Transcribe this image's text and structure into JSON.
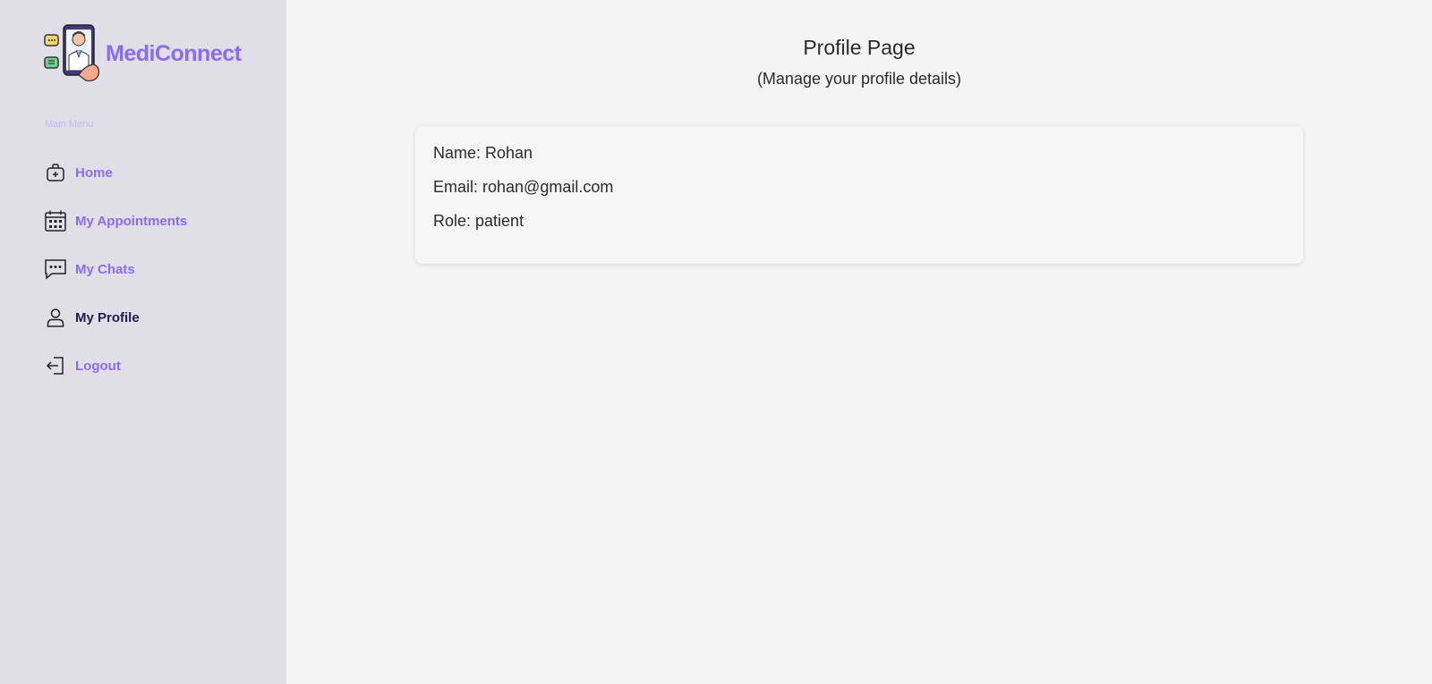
{
  "sidebar": {
    "brand": "MediConnect",
    "menu_heading": "Main Menu",
    "items": [
      {
        "label": "Home",
        "icon": "medical-bag-icon",
        "active": false
      },
      {
        "label": "My Appointments",
        "icon": "calendar-icon",
        "active": false
      },
      {
        "label": "My Chats",
        "icon": "chat-icon",
        "active": false
      },
      {
        "label": "My Profile",
        "icon": "user-icon",
        "active": true
      },
      {
        "label": "Logout",
        "icon": "logout-icon",
        "active": false
      }
    ]
  },
  "main": {
    "title": "Profile Page",
    "subtitle": "(Manage your profile details)",
    "profile": {
      "name": "Name: Rohan",
      "email": "Email: rohan@gmail.com",
      "role": "Role: patient"
    }
  },
  "colors": {
    "accent": "#8b6cf0",
    "active_text": "#231b4a",
    "sidebar_bg": "#e0dfe8",
    "page_bg": "#f4f4f4"
  }
}
